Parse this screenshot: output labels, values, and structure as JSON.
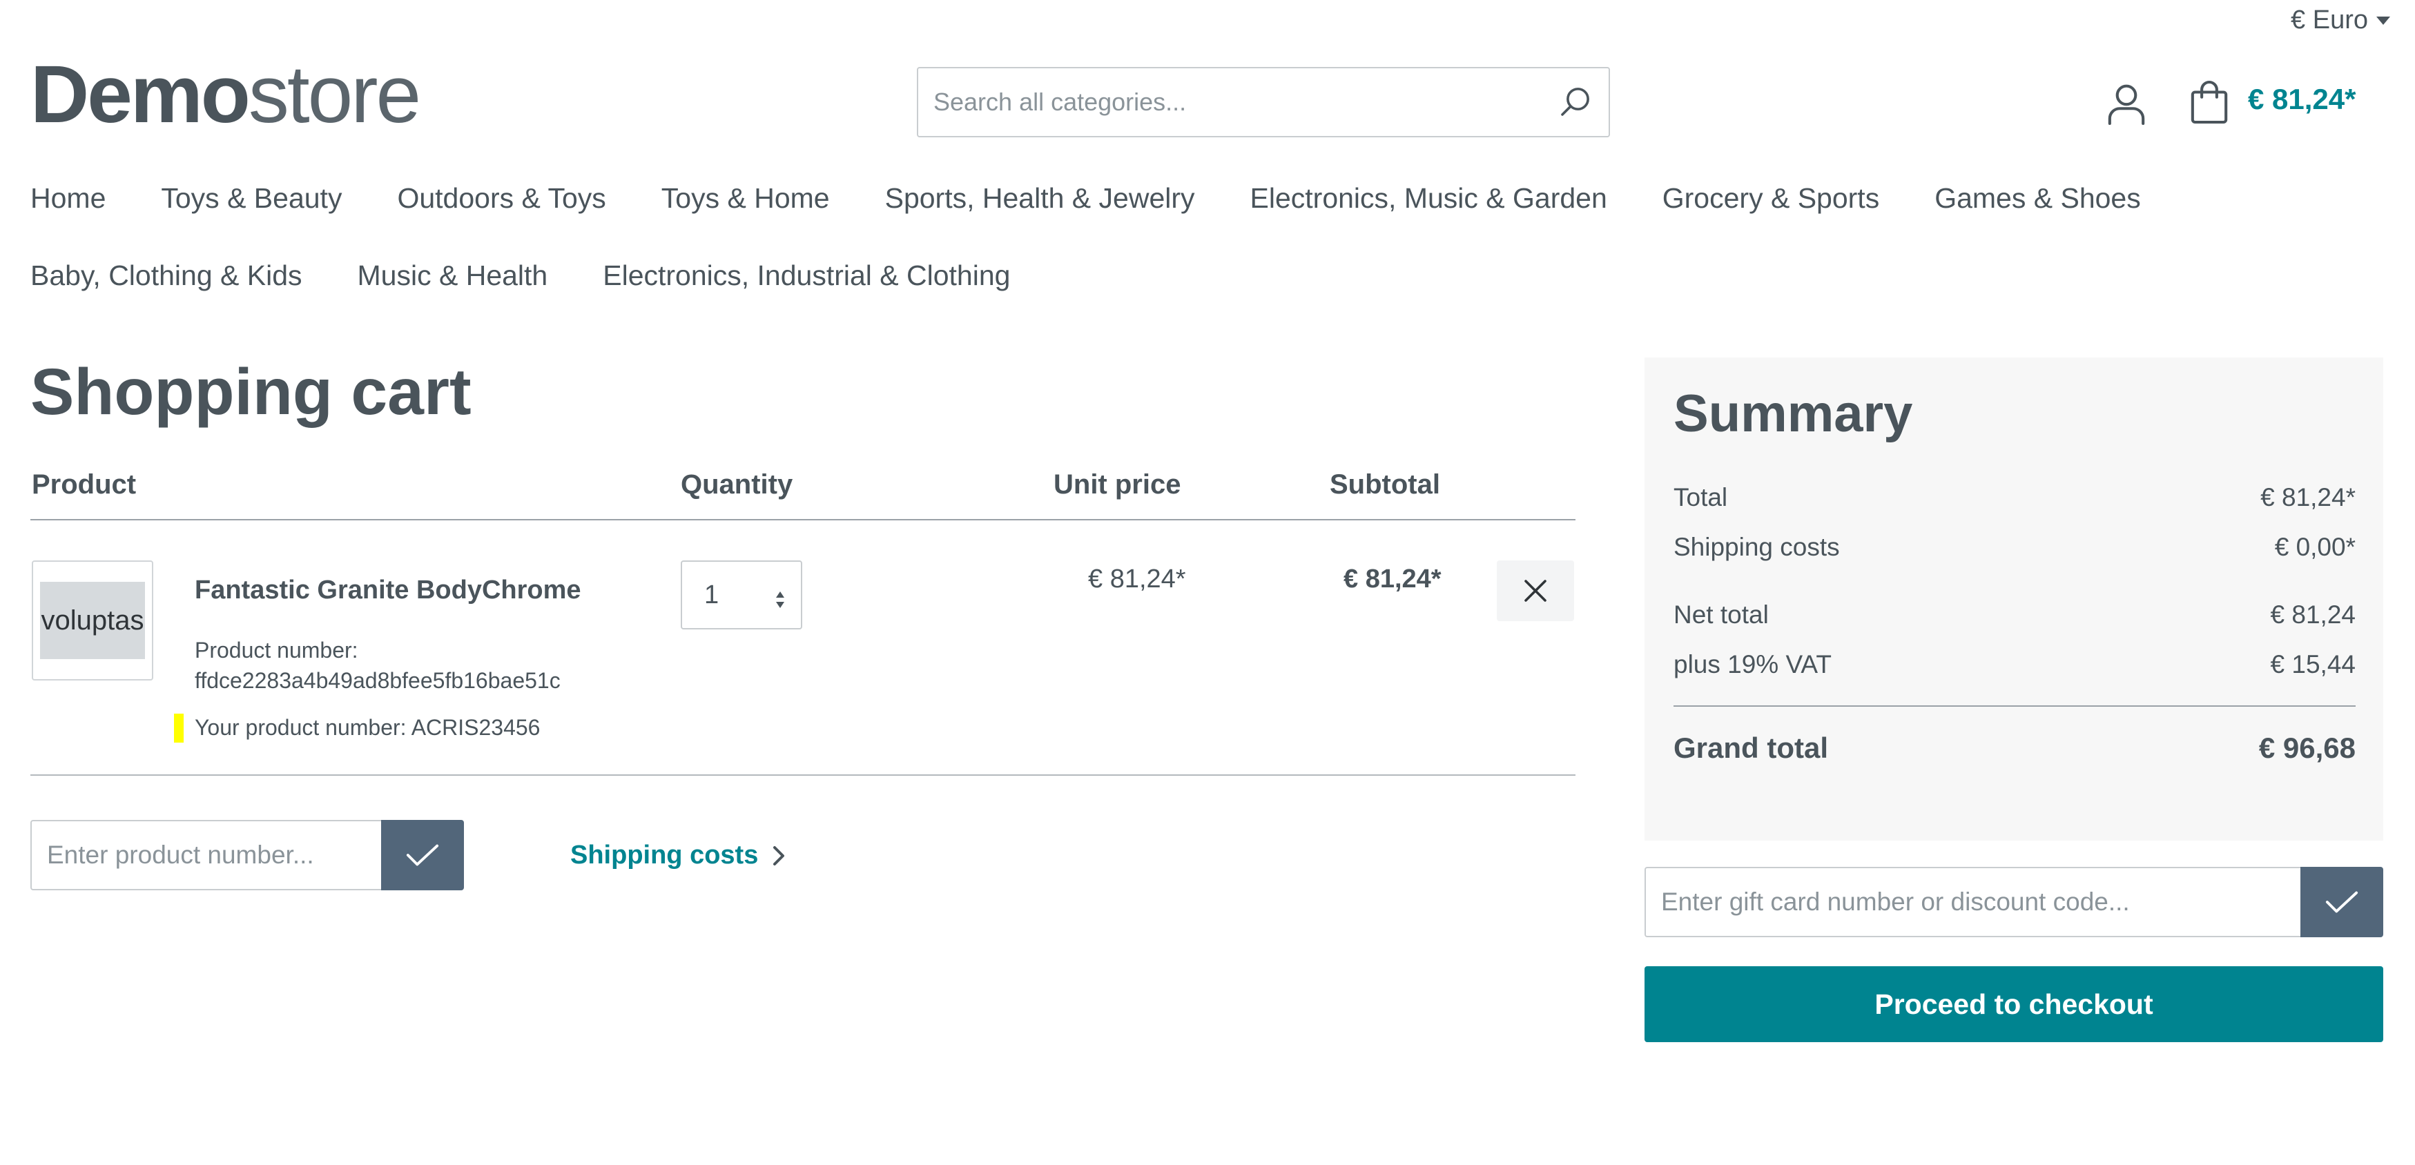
{
  "top_bar": {
    "currency": "€ Euro"
  },
  "header": {
    "logo_bold": "Demo",
    "logo_light": "store",
    "search_placeholder": "Search all categories...",
    "cart_total": "€ 81,24*"
  },
  "nav": {
    "items": [
      "Home",
      "Toys & Beauty",
      "Outdoors & Toys",
      "Toys & Home",
      "Sports, Health & Jewelry",
      "Electronics, Music & Garden",
      "Grocery & Sports",
      "Games & Shoes",
      "Baby, Clothing & Kids",
      "Music & Health",
      "Electronics, Industrial & Clothing"
    ]
  },
  "cart": {
    "title": "Shopping cart",
    "headers": {
      "product": "Product",
      "quantity": "Quantity",
      "unit_price": "Unit price",
      "subtotal": "Subtotal"
    },
    "item": {
      "image_text": "voluptas",
      "name": "Fantastic Granite BodyChrome",
      "product_number_label": "Product number:",
      "product_number": "ffdce2283a4b49ad8bfee5fb16bae51c",
      "your_product_number": "Your product number: ACRIS23456",
      "quantity": "1",
      "unit_price": "€ 81,24*",
      "subtotal": "€ 81,24*"
    },
    "product_number_placeholder": "Enter product number...",
    "shipping_link": "Shipping costs"
  },
  "summary": {
    "title": "Summary",
    "rows": [
      {
        "label": "Total",
        "value": "€ 81,24*"
      },
      {
        "label": "Shipping costs",
        "value": "€ 0,00*"
      },
      {
        "label": "Net total",
        "value": "€ 81,24"
      },
      {
        "label": "plus 19% VAT",
        "value": "€ 15,44"
      }
    ],
    "grand_total_label": "Grand total",
    "grand_total_value": "€ 96,68",
    "gift_placeholder": "Enter gift card number or discount code...",
    "checkout_label": "Proceed to checkout"
  },
  "colors": {
    "brand": "#008490",
    "text": "#4a545b",
    "button_dark": "#52667a",
    "summary_bg": "#f7f7f7",
    "highlight": "#ffff00"
  }
}
